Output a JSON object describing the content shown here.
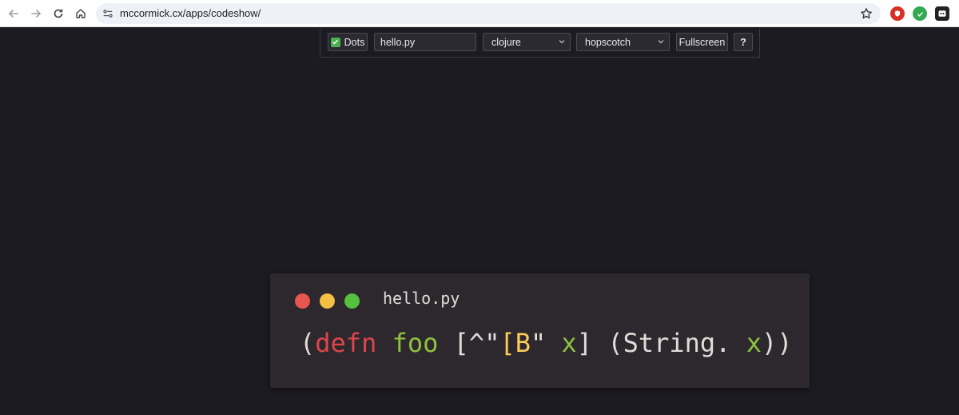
{
  "browser": {
    "url": "mccormick.cx/apps/codeshow/",
    "icons": [
      "back-icon",
      "forward-icon",
      "reload-icon",
      "home-icon",
      "site-settings-icon",
      "bookmark-star-icon",
      "ublock-extension-icon",
      "check-extension-icon",
      "profile-extension-icon"
    ]
  },
  "toolbar": {
    "dots_label": "Dots",
    "dots_checked": true,
    "filename_value": "hello.py",
    "language_value": "clojure",
    "theme_value": "hopscotch",
    "fullscreen_label": "Fullscreen",
    "help_label": "?"
  },
  "card": {
    "filename": "hello.py",
    "dots": [
      "#e6564f",
      "#f4c043",
      "#55c23e"
    ],
    "code_tokens": [
      {
        "text": "(",
        "color": "#e0dcd7"
      },
      {
        "text": "defn",
        "color": "#dd464c"
      },
      {
        "text": " ",
        "color": "#e0dcd7"
      },
      {
        "text": "foo",
        "color": "#8fc13e"
      },
      {
        "text": " [^\"",
        "color": "#e0dcd7"
      },
      {
        "text": "[B",
        "color": "#fdcc59"
      },
      {
        "text": "\" ",
        "color": "#e0dcd7"
      },
      {
        "text": "x",
        "color": "#8fc13e"
      },
      {
        "text": "] (String. ",
        "color": "#e0dcd7"
      },
      {
        "text": "x",
        "color": "#8fc13e"
      },
      {
        "text": "))",
        "color": "#e0dcd7"
      }
    ]
  },
  "colors": {
    "page_bg": "#1c1b22",
    "card_bg": "#2d282d"
  }
}
